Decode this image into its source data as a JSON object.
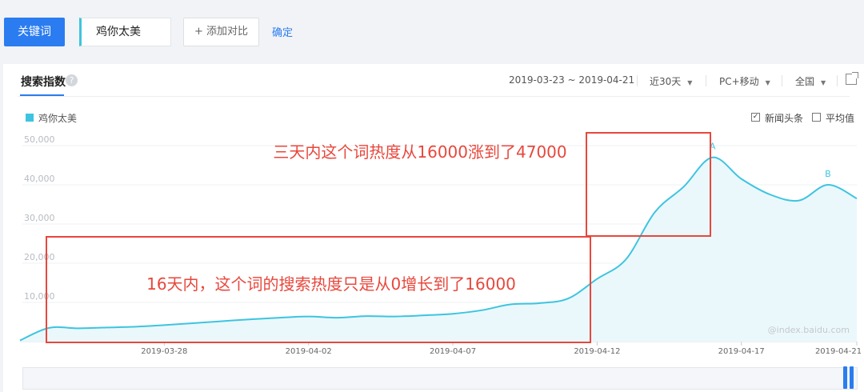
{
  "toolbar": {
    "keyword_button": "关键词",
    "keyword_value": "鸡你太美",
    "add_compare": "+ 添加对比",
    "confirm": "确定"
  },
  "panel": {
    "tab_title": "搜索指数",
    "help_icon": "?",
    "date_range": "2019-03-23 ~ 2019-04-21",
    "period": "近30天",
    "device": "PC+移动",
    "region": "全国",
    "legend_label": "鸡你太美",
    "news_checkbox": "新闻头条",
    "avg_checkbox": "平均值",
    "news_checked": true,
    "avg_checked": false,
    "watermark": "@index.baidu.com"
  },
  "annotations": {
    "box1_text": "三天内这个词热度从16000涨到了47000",
    "box2_text": "16天内，这个词的搜索热度只是从0增长到了16000",
    "marker_a": "A",
    "marker_b": "B",
    "box_color": "#e8473c"
  },
  "colors": {
    "accent": "#2b7cf0",
    "series": "#3ec4e0",
    "series_fill": "#eaf8fc"
  },
  "chart_data": {
    "type": "area",
    "ylim": [
      0,
      50000
    ],
    "yticks": [
      "10,000",
      "20,000",
      "30,000",
      "40,000",
      "50,000"
    ],
    "ytick_values": [
      10000,
      20000,
      30000,
      40000,
      50000
    ],
    "xtick_labels": [
      "2019-03-28",
      "2019-04-02",
      "2019-04-07",
      "2019-04-12",
      "2019-04-17",
      "2019-04-21"
    ],
    "xtick_index": [
      5,
      10,
      15,
      20,
      25,
      29
    ],
    "x": [
      "2019-03-23",
      "2019-03-24",
      "2019-03-25",
      "2019-03-26",
      "2019-03-27",
      "2019-03-28",
      "2019-03-29",
      "2019-03-30",
      "2019-03-31",
      "2019-04-01",
      "2019-04-02",
      "2019-04-03",
      "2019-04-04",
      "2019-04-05",
      "2019-04-06",
      "2019-04-07",
      "2019-04-08",
      "2019-04-09",
      "2019-04-10",
      "2019-04-11",
      "2019-04-12",
      "2019-04-13",
      "2019-04-14",
      "2019-04-15",
      "2019-04-16",
      "2019-04-17",
      "2019-04-18",
      "2019-04-19",
      "2019-04-20",
      "2019-04-21"
    ],
    "series": [
      {
        "name": "鸡你太美",
        "values": [
          300,
          3500,
          3400,
          3600,
          3800,
          4200,
          4700,
          5200,
          5700,
          6100,
          6400,
          6100,
          6500,
          6400,
          6700,
          7100,
          8000,
          9500,
          9800,
          11000,
          16000,
          21000,
          33000,
          39500,
          47000,
          41500,
          37500,
          36000,
          40000,
          36500
        ]
      }
    ],
    "markers": [
      {
        "label": "A",
        "index": 24
      },
      {
        "label": "B",
        "index": 28
      }
    ],
    "grid": true
  }
}
